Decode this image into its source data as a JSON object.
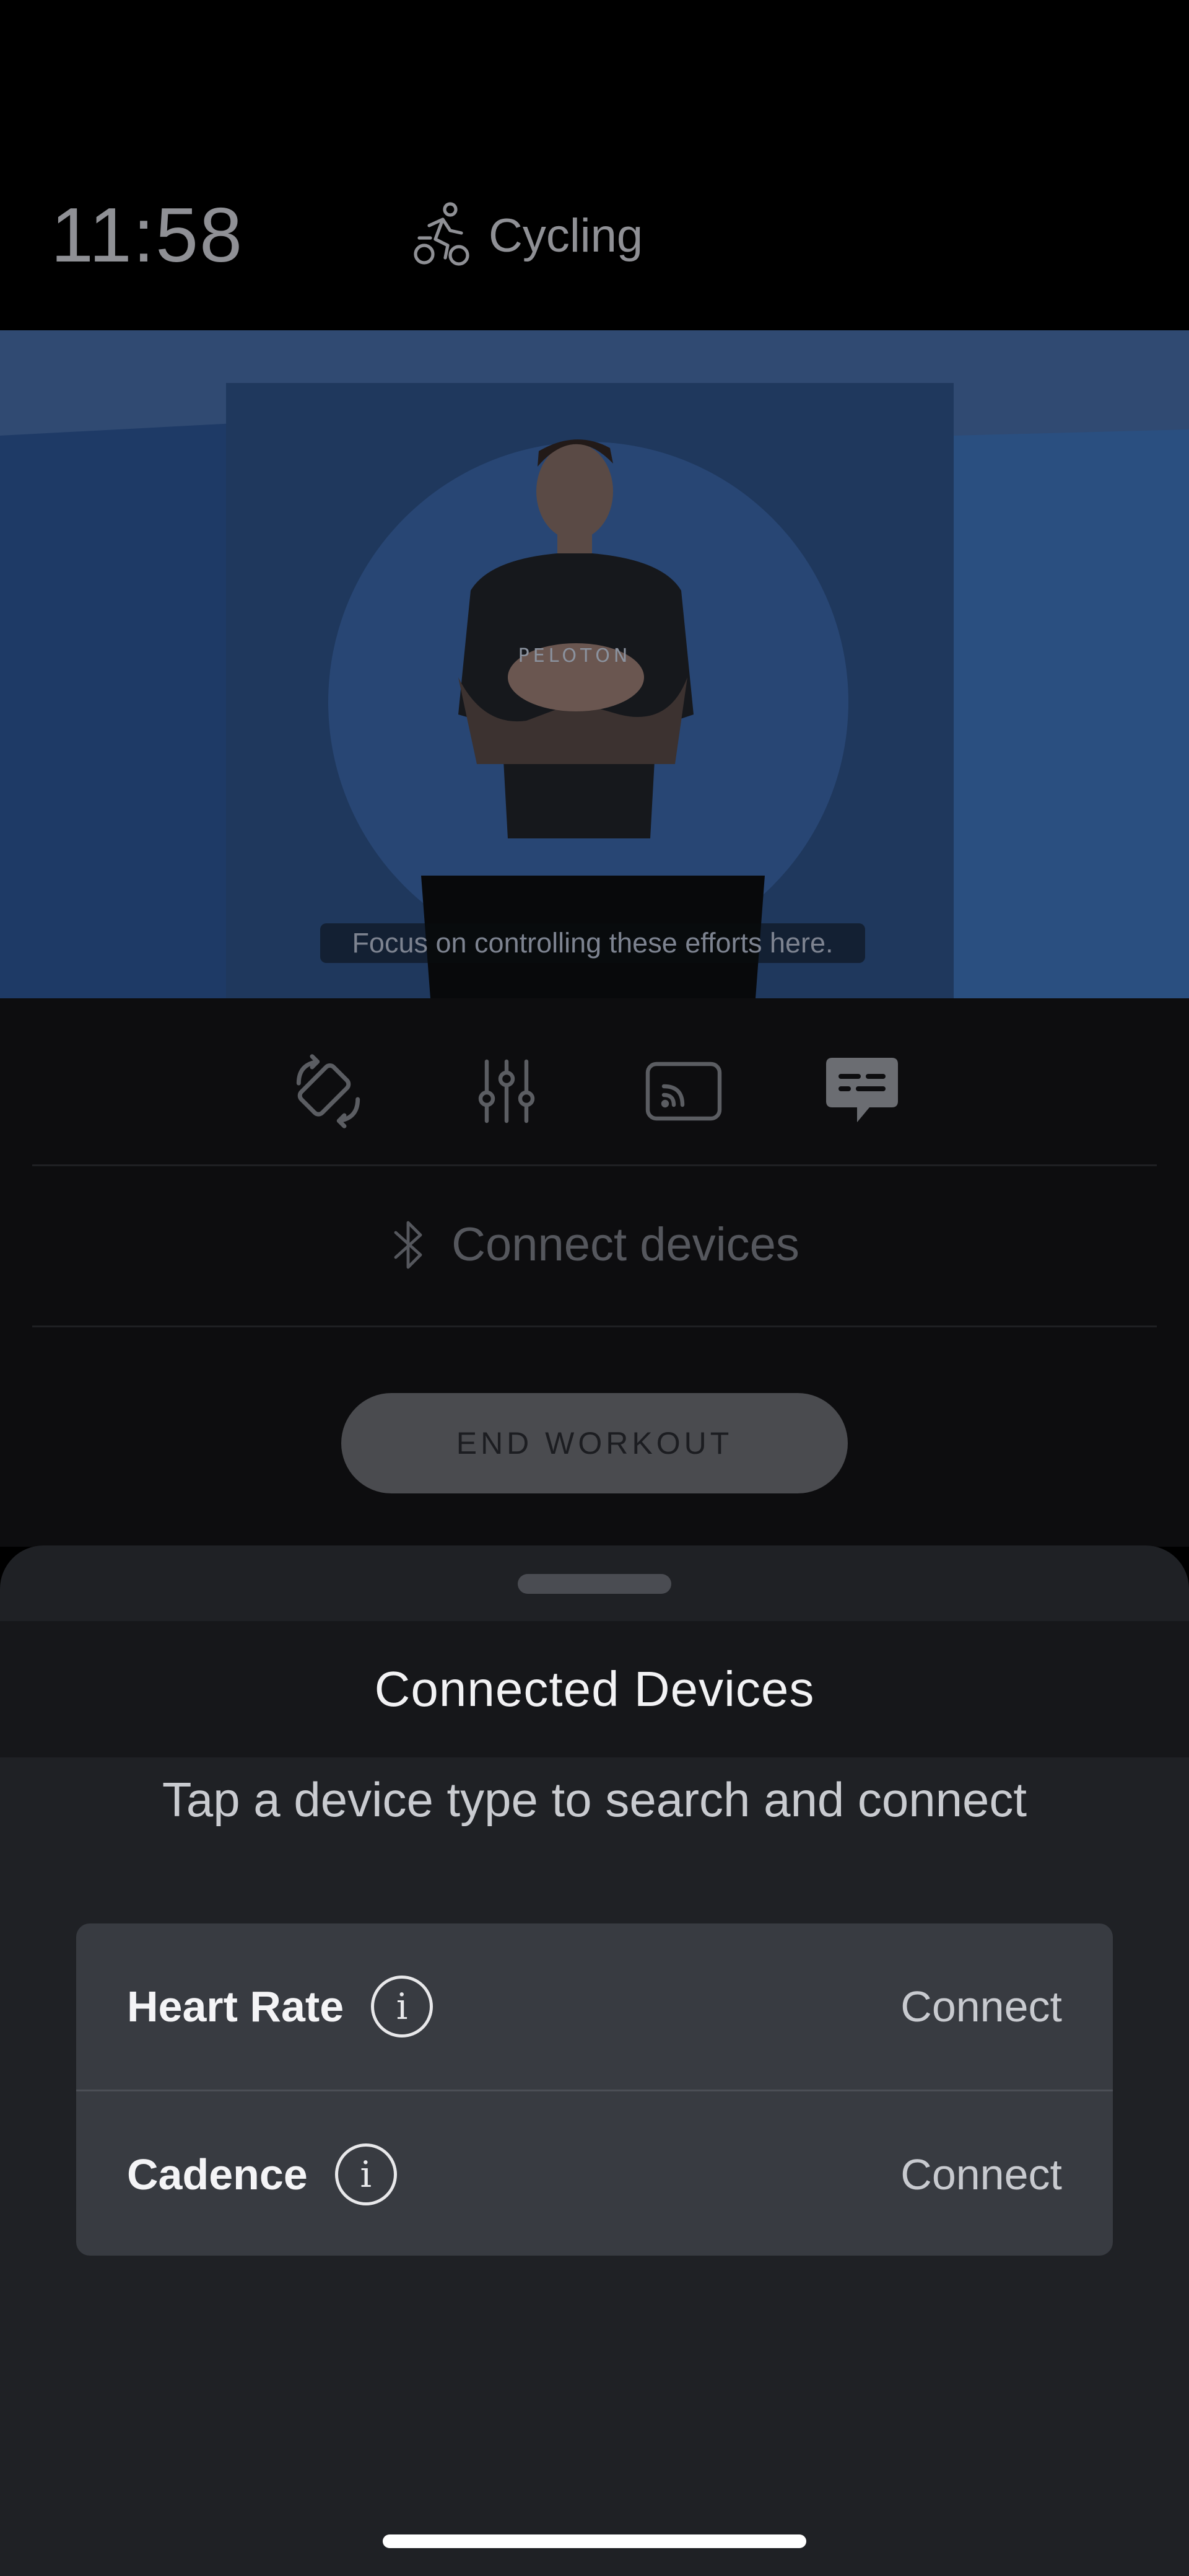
{
  "status": {
    "time": "11:58",
    "activity": "Cycling"
  },
  "video": {
    "caption": "Focus on controlling these efforts here.",
    "shirt_text": "PELOTON"
  },
  "controls": {
    "icons": [
      "rotate-screen-icon",
      "sliders-icon",
      "cast-icon",
      "subtitles-icon"
    ],
    "connect_devices_label": "Connect devices",
    "end_workout_label": "END WORKOUT"
  },
  "sheet": {
    "title": "Connected Devices",
    "subtitle": "Tap a device type to search and connect",
    "devices": [
      {
        "name": "Heart Rate",
        "action": "Connect"
      },
      {
        "name": "Cadence",
        "action": "Connect"
      }
    ]
  },
  "colors": {
    "background": "#000000",
    "sheet": "#1f2125",
    "card": "#383b41",
    "end_button": "#4a4b4f"
  }
}
